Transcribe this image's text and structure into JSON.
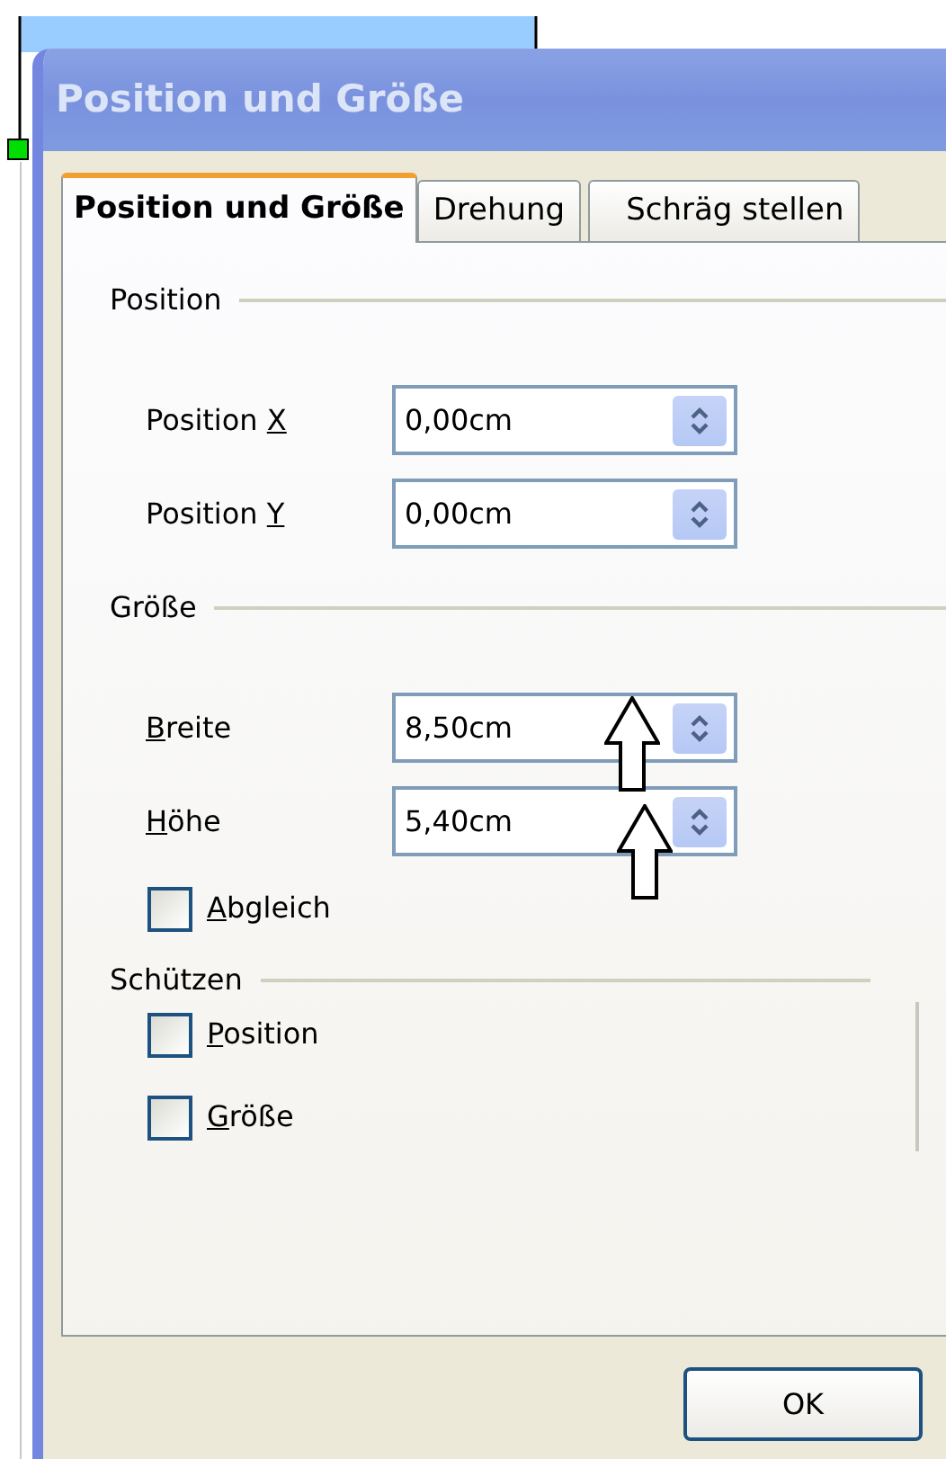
{
  "window": {
    "title": "Position und Größe"
  },
  "tabs": [
    {
      "label": "Position und Größe",
      "selected": true
    },
    {
      "label": "Drehung",
      "selected": false
    },
    {
      "label": "Schräg stellen",
      "selected": false
    }
  ],
  "groups": [
    {
      "title": "Position",
      "kind": "fields",
      "items": [
        {
          "pre": "Position ",
          "key": "X",
          "value": "0,00cm"
        },
        {
          "pre": "Position ",
          "key": "Y",
          "value": "0,00cm"
        }
      ]
    },
    {
      "title": "Größe",
      "kind": "fields",
      "items": [
        {
          "key": "B",
          "post": "reite",
          "value": "8,50cm"
        },
        {
          "key": "H",
          "post": "öhe",
          "value": "5,40cm"
        }
      ],
      "checkboxes": [
        {
          "key": "A",
          "post": "bgleich",
          "checked": false
        }
      ]
    },
    {
      "title": "Schützen",
      "kind": "checks",
      "checkboxes": [
        {
          "key": "P",
          "post": "osition",
          "checked": false
        },
        {
          "key": "G",
          "post": "röße",
          "checked": false
        }
      ]
    }
  ],
  "annotations": [
    {
      "kind": "up-arrow"
    },
    {
      "kind": "up-arrow"
    }
  ],
  "buttons": [
    {
      "label": "OK"
    }
  ]
}
